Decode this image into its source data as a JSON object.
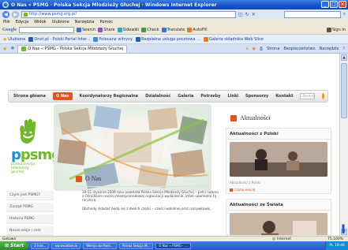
{
  "window": {
    "title": "O Nas « PSMG · Polska Sekcja Młodzieży Głuchej · Windows Internet Explorer",
    "controls": [
      "_",
      "□",
      "×"
    ]
  },
  "address_bar": {
    "back": "◀",
    "forward": "▶",
    "url": "http://www.psmg.org.pl/"
  },
  "menu_bar": [
    "Plik",
    "Edycja",
    "Widok",
    "Ulubione",
    "Narzędzia",
    "Pomoc"
  ],
  "google_toolbar": {
    "logo": "Google",
    "items": [
      {
        "label": "Search",
        "color": "#3b6fd8"
      },
      {
        "label": "Share",
        "color": "#8a4fc9"
      },
      {
        "label": "Sidewiki",
        "color": "#2fa2d8"
      },
      {
        "label": "Check",
        "color": "#3c9a3c"
      },
      {
        "label": "Translate",
        "color": "#3b6fd8"
      },
      {
        "label": "AutoFill",
        "color": "#e07a24"
      },
      {
        "label": "Sign In",
        "color": "#555555"
      }
    ]
  },
  "favorites_bar": {
    "label": "Ulubione",
    "items": [
      "Onet.pl - Polski Portal Inter...",
      "Polecane witryny",
      "Bezpłatna usługa pocztowa ...",
      "Galeria składnika Web Slice"
    ]
  },
  "tabs": [
    {
      "label": "O Nas « PSMG - Polska Sekcja Młodzieży Głuchej"
    }
  ],
  "command_bar": [
    "Strona",
    "Bezpieczeństwo",
    "Narzędzia"
  ],
  "site": {
    "nav": [
      "Strona główna",
      "O Nas",
      "Koordynatorzy Regionalne",
      "Działalność",
      "Galeria",
      "Potrzeby",
      "Linki",
      "Sponsorzy",
      "Kontakt"
    ],
    "active_nav": 1,
    "search_placeholder": "Szukaj",
    "logo": {
      "mark": "psmg",
      "sub": "polska sekcja młodzieży głuchej"
    },
    "left_menu": [
      "Czym jest PSMG?",
      "Zarząd PSMG",
      "Historia PSMG",
      "Nasze wizje i cele"
    ],
    "about": {
      "title": "O Nas",
      "p1": "10-11 stycznia 2009 roku powstała Polska Sekcja Młodzieży Głuchej – pełni naboru z Ośrodkiem naszej międzynarodowej organizacji wydarzenie, które upamiętni tą rocznicę.",
      "p2": "Obchody składać będą się z dwóch części – części wokalnej oraz rozrywkowej."
    },
    "news": {
      "title": "Aktualności",
      "poland": {
        "title": "Aktualności z Polski",
        "caption": "Aktualności z Polski",
        "more": "Czytaj więcej"
      },
      "world": {
        "title": "Aktualności ze Świata"
      }
    }
  },
  "status_bar": {
    "left": "Gotowe",
    "zone": "Internet",
    "zoom": "75,100%"
  },
  "taskbar": {
    "start": "Start",
    "tasks": [
      "3 Inte...",
      "wprowadzenie",
      "Wersja do Pami...",
      "Polska Sekcja M...",
      "O Nas « PSMG - ..."
    ],
    "tray": "PL  18:46"
  },
  "cursor_label": "I",
  "colors": {
    "accent": "#e2541c",
    "title_bar": "#1656c9",
    "logo_green": "#6fb82a",
    "logo_blue": "#1e8fd0"
  }
}
